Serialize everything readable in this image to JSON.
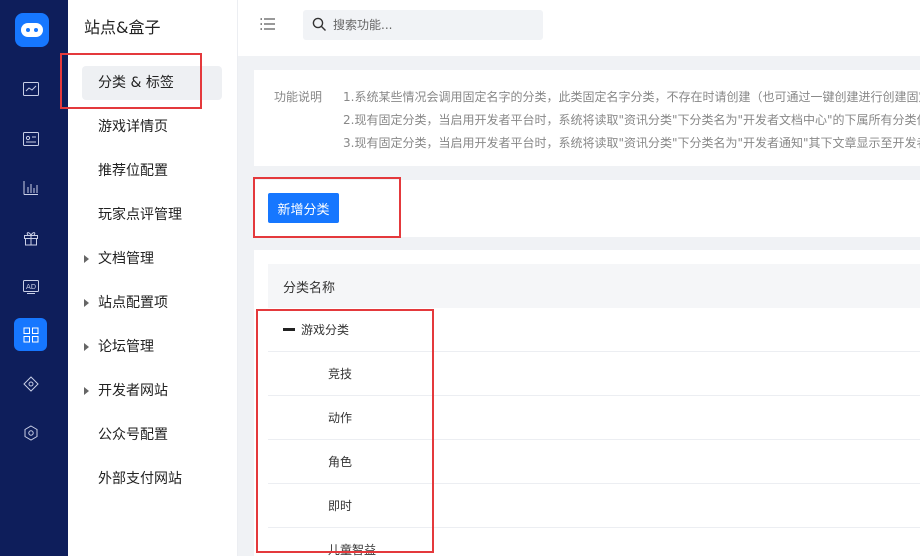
{
  "sidebar": {
    "brand": "站点&盒子",
    "items": [
      {
        "label": "分类 & 标签",
        "active": true,
        "expandable": false
      },
      {
        "label": "游戏详情页",
        "active": false,
        "expandable": false
      },
      {
        "label": "推荐位配置",
        "active": false,
        "expandable": false
      },
      {
        "label": "玩家点评管理",
        "active": false,
        "expandable": false
      },
      {
        "label": "文档管理",
        "active": false,
        "expandable": true
      },
      {
        "label": "站点配置项",
        "active": false,
        "expandable": true
      },
      {
        "label": "论坛管理",
        "active": false,
        "expandable": true
      },
      {
        "label": "开发者网站",
        "active": false,
        "expandable": true
      },
      {
        "label": "公众号配置",
        "active": false,
        "expandable": false
      },
      {
        "label": "外部支付网站",
        "active": false,
        "expandable": false
      }
    ]
  },
  "rail_icons": [
    "chart-line-icon",
    "id-card-icon",
    "bar-chart-icon",
    "gift-icon",
    "ad-icon",
    "grid-icon",
    "tag-icon",
    "settings-icon"
  ],
  "search": {
    "placeholder": "搜索功能...",
    "value": ""
  },
  "description": {
    "label": "功能说明",
    "lines": [
      "1.系统某些情况会调用固定名字的分类，此类固定名字分类，不存在时请创建（也可通过一键创建进行创建固定",
      "2.现有固定分类，当启用开发者平台时，系统将读取\"资讯分类\"下分类名为\"开发者文档中心\"的下属所有分类作",
      "3.现有固定分类，当启用开发者平台时，系统将读取\"资讯分类\"下分类名为\"开发者通知\"其下文章显示至开发者"
    ]
  },
  "actions": {
    "add_category": "新增分类"
  },
  "table": {
    "header": "分类名称",
    "rows": [
      {
        "label": "游戏分类",
        "level": 0,
        "expanded": true
      },
      {
        "label": "竞技",
        "level": 1
      },
      {
        "label": "动作",
        "level": 1
      },
      {
        "label": "角色",
        "level": 1
      },
      {
        "label": "即时",
        "level": 1
      },
      {
        "label": "儿童智益",
        "level": 1
      }
    ]
  },
  "colors": {
    "accent": "#1677ff",
    "rail_bg": "#0e1e5b",
    "annotation": "#e4393c"
  }
}
